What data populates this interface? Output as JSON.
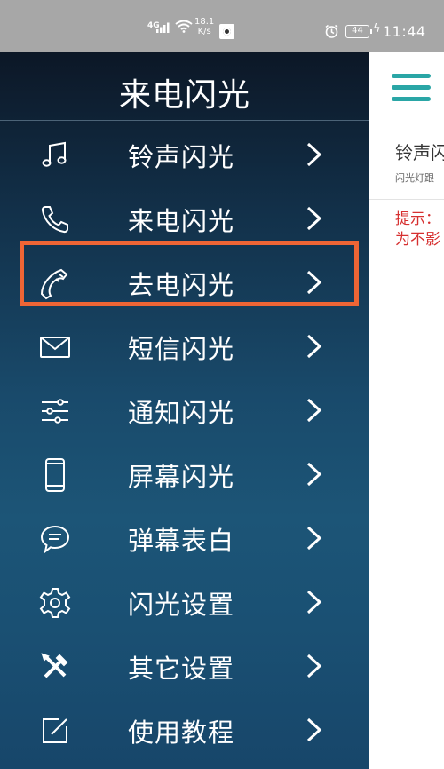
{
  "status_bar": {
    "network": "4G",
    "speed_value": "18.1",
    "speed_unit": "K/s",
    "battery": "44",
    "time": "11:44",
    "icons": [
      "signal-icon",
      "wifi-icon",
      "nfc-icon",
      "alarm-icon",
      "battery-icon",
      "charging-icon"
    ]
  },
  "drawer": {
    "title": "来电闪光",
    "items": [
      {
        "label": "铃声闪光",
        "icon": "music-note-icon"
      },
      {
        "label": "来电闪光",
        "icon": "phone-incoming-icon",
        "highlighted": true
      },
      {
        "label": "去电闪光",
        "icon": "phone-outgoing-icon"
      },
      {
        "label": "短信闪光",
        "icon": "mail-icon"
      },
      {
        "label": "通知闪光",
        "icon": "sliders-icon"
      },
      {
        "label": "屏幕闪光",
        "icon": "smartphone-icon"
      },
      {
        "label": "弹幕表白",
        "icon": "chat-bubble-icon"
      },
      {
        "label": "闪光设置",
        "icon": "gear-icon"
      },
      {
        "label": "其它设置",
        "icon": "tools-icon"
      },
      {
        "label": "使用教程",
        "icon": "edit-icon"
      }
    ],
    "highlight_color": "#ee6535"
  },
  "main": {
    "menu_icon": "hamburger-icon",
    "card_title": "铃声闪",
    "card_subtitle": "闪光灯跟",
    "tip_line1": "提示：",
    "tip_line2": "为不影",
    "accent_color": "#2aa6a6",
    "tip_color": "#d63030"
  }
}
